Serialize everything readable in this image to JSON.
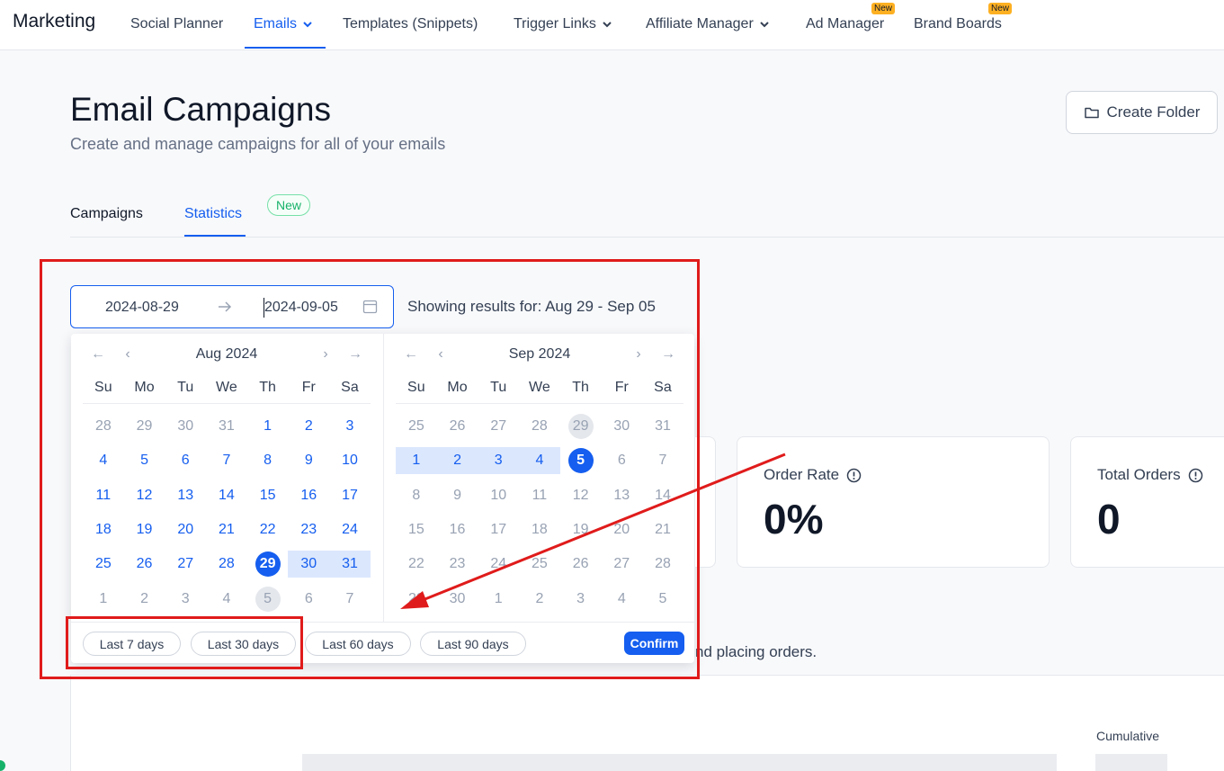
{
  "nav": {
    "brand": "Marketing",
    "items": [
      {
        "label": "Social Planner"
      },
      {
        "label": "Emails"
      },
      {
        "label": "Templates (Snippets)"
      },
      {
        "label": "Trigger Links"
      },
      {
        "label": "Affiliate Manager"
      },
      {
        "label": "Ad Manager",
        "badge": "New"
      },
      {
        "label": "Brand Boards",
        "badge": "New"
      }
    ]
  },
  "header": {
    "title": "Email Campaigns",
    "subtitle": "Create and manage campaigns for all of your emails",
    "create_folder": "Create Folder"
  },
  "tabs": {
    "campaigns": "Campaigns",
    "statistics": "Statistics",
    "new_pill": "New"
  },
  "range": {
    "start": "2024-08-29",
    "end": "2024-09-05",
    "showing": "Showing results for: Aug 29 - Sep 05"
  },
  "calendar": {
    "dow": [
      "Su",
      "Mo",
      "Tu",
      "We",
      "Th",
      "Fr",
      "Sa"
    ],
    "left": {
      "title": "Aug 2024",
      "weeks": [
        [
          [
            "28",
            "other"
          ],
          [
            "29",
            "other"
          ],
          [
            "30",
            "other"
          ],
          [
            "31",
            "other"
          ],
          [
            "1",
            "cur"
          ],
          [
            "2",
            "cur"
          ],
          [
            "3",
            "cur"
          ]
        ],
        [
          [
            "4",
            "cur"
          ],
          [
            "5",
            "cur"
          ],
          [
            "6",
            "cur"
          ],
          [
            "7",
            "cur"
          ],
          [
            "8",
            "cur"
          ],
          [
            "9",
            "cur"
          ],
          [
            "10",
            "cur"
          ]
        ],
        [
          [
            "11",
            "cur"
          ],
          [
            "12",
            "cur"
          ],
          [
            "13",
            "cur"
          ],
          [
            "14",
            "cur"
          ],
          [
            "15",
            "cur"
          ],
          [
            "16",
            "cur"
          ],
          [
            "17",
            "cur"
          ]
        ],
        [
          [
            "18",
            "cur"
          ],
          [
            "19",
            "cur"
          ],
          [
            "20",
            "cur"
          ],
          [
            "21",
            "cur"
          ],
          [
            "22",
            "cur"
          ],
          [
            "23",
            "cur"
          ],
          [
            "24",
            "cur"
          ]
        ],
        [
          [
            "25",
            "cur"
          ],
          [
            "26",
            "cur"
          ],
          [
            "27",
            "cur"
          ],
          [
            "28",
            "cur"
          ],
          [
            "29",
            "sel"
          ],
          [
            "30",
            "cur inrange"
          ],
          [
            "31",
            "cur inrange"
          ]
        ],
        [
          [
            "1",
            "other"
          ],
          [
            "2",
            "other"
          ],
          [
            "3",
            "other"
          ],
          [
            "4",
            "other"
          ],
          [
            "5",
            "other today"
          ],
          [
            "6",
            "other"
          ],
          [
            "7",
            "other"
          ]
        ]
      ]
    },
    "right": {
      "title": "Sep 2024",
      "weeks": [
        [
          [
            "25",
            "other"
          ],
          [
            "26",
            "other"
          ],
          [
            "27",
            "other"
          ],
          [
            "28",
            "other"
          ],
          [
            "29",
            "other today"
          ],
          [
            "30",
            "other"
          ],
          [
            "31",
            "other"
          ]
        ],
        [
          [
            "1",
            "cur inrange"
          ],
          [
            "2",
            "cur inrange"
          ],
          [
            "3",
            "cur inrange"
          ],
          [
            "4",
            "cur inrange"
          ],
          [
            "5",
            "sel"
          ],
          [
            "6",
            "dim"
          ],
          [
            "7",
            "dim"
          ]
        ],
        [
          [
            "8",
            "dim"
          ],
          [
            "9",
            "dim"
          ],
          [
            "10",
            "dim"
          ],
          [
            "11",
            "dim"
          ],
          [
            "12",
            "dim"
          ],
          [
            "13",
            "dim"
          ],
          [
            "14",
            "dim"
          ]
        ],
        [
          [
            "15",
            "dim"
          ],
          [
            "16",
            "dim"
          ],
          [
            "17",
            "dim"
          ],
          [
            "18",
            "dim"
          ],
          [
            "19",
            "dim"
          ],
          [
            "20",
            "dim"
          ],
          [
            "21",
            "dim"
          ]
        ],
        [
          [
            "22",
            "dim"
          ],
          [
            "23",
            "dim"
          ],
          [
            "24",
            "dim"
          ],
          [
            "25",
            "dim"
          ],
          [
            "26",
            "dim"
          ],
          [
            "27",
            "dim"
          ],
          [
            "28",
            "dim"
          ]
        ],
        [
          [
            "29",
            "dim"
          ],
          [
            "30",
            "dim"
          ],
          [
            "1",
            "other"
          ],
          [
            "2",
            "other"
          ],
          [
            "3",
            "other"
          ],
          [
            "4",
            "other"
          ],
          [
            "5",
            "other"
          ]
        ]
      ]
    },
    "presets": [
      "Last 7 days",
      "Last 30 days",
      "Last 60 days",
      "Last 90 days"
    ],
    "confirm": "Confirm"
  },
  "stats": {
    "order_rate_label": "Order Rate",
    "order_rate_value": "0%",
    "total_orders_label": "Total Orders",
    "total_orders_value": "0"
  },
  "helper_text": "nd placing orders.",
  "chart": {
    "cumulative": "Cumulative"
  },
  "colors": {
    "accent": "#155eef",
    "annotation": "#e01b1b"
  }
}
